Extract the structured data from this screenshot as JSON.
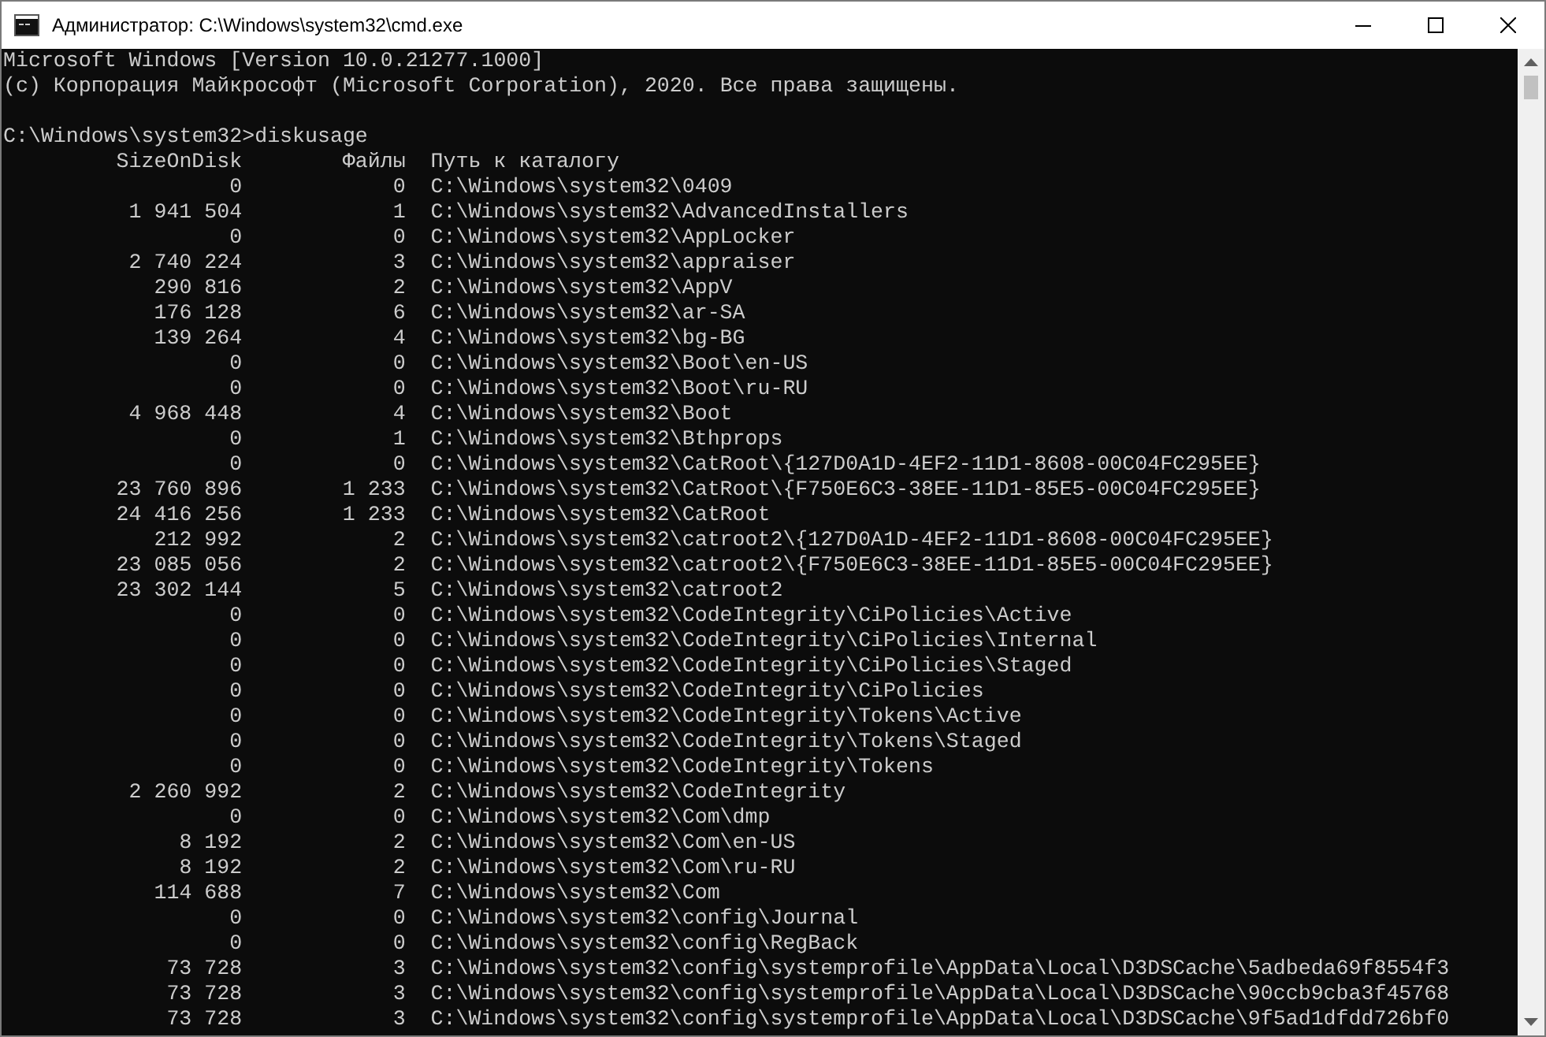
{
  "window": {
    "title": "Администратор: C:\\Windows\\system32\\cmd.exe"
  },
  "console": {
    "banner": [
      "Microsoft Windows [Version 10.0.21277.1000]",
      "(c) Корпорация Майкрософт (Microsoft Corporation), 2020. Все права защищены."
    ],
    "prompt": "C:\\Windows\\system32>diskusage",
    "table": {
      "columns": [
        "SizeOnDisk",
        "Файлы",
        "Путь к каталогу"
      ],
      "rows": [
        {
          "size": "0",
          "files": "0",
          "path": "C:\\Windows\\system32\\0409"
        },
        {
          "size": "1 941 504",
          "files": "1",
          "path": "C:\\Windows\\system32\\AdvancedInstallers"
        },
        {
          "size": "0",
          "files": "0",
          "path": "C:\\Windows\\system32\\AppLocker"
        },
        {
          "size": "2 740 224",
          "files": "3",
          "path": "C:\\Windows\\system32\\appraiser"
        },
        {
          "size": "290 816",
          "files": "2",
          "path": "C:\\Windows\\system32\\AppV"
        },
        {
          "size": "176 128",
          "files": "6",
          "path": "C:\\Windows\\system32\\ar-SA"
        },
        {
          "size": "139 264",
          "files": "4",
          "path": "C:\\Windows\\system32\\bg-BG"
        },
        {
          "size": "0",
          "files": "0",
          "path": "C:\\Windows\\system32\\Boot\\en-US"
        },
        {
          "size": "0",
          "files": "0",
          "path": "C:\\Windows\\system32\\Boot\\ru-RU"
        },
        {
          "size": "4 968 448",
          "files": "4",
          "path": "C:\\Windows\\system32\\Boot"
        },
        {
          "size": "0",
          "files": "1",
          "path": "C:\\Windows\\system32\\Bthprops"
        },
        {
          "size": "0",
          "files": "0",
          "path": "C:\\Windows\\system32\\CatRoot\\{127D0A1D-4EF2-11D1-8608-00C04FC295EE}"
        },
        {
          "size": "23 760 896",
          "files": "1 233",
          "path": "C:\\Windows\\system32\\CatRoot\\{F750E6C3-38EE-11D1-85E5-00C04FC295EE}"
        },
        {
          "size": "24 416 256",
          "files": "1 233",
          "path": "C:\\Windows\\system32\\CatRoot"
        },
        {
          "size": "212 992",
          "files": "2",
          "path": "C:\\Windows\\system32\\catroot2\\{127D0A1D-4EF2-11D1-8608-00C04FC295EE}"
        },
        {
          "size": "23 085 056",
          "files": "2",
          "path": "C:\\Windows\\system32\\catroot2\\{F750E6C3-38EE-11D1-85E5-00C04FC295EE}"
        },
        {
          "size": "23 302 144",
          "files": "5",
          "path": "C:\\Windows\\system32\\catroot2"
        },
        {
          "size": "0",
          "files": "0",
          "path": "C:\\Windows\\system32\\CodeIntegrity\\CiPolicies\\Active"
        },
        {
          "size": "0",
          "files": "0",
          "path": "C:\\Windows\\system32\\CodeIntegrity\\CiPolicies\\Internal"
        },
        {
          "size": "0",
          "files": "0",
          "path": "C:\\Windows\\system32\\CodeIntegrity\\CiPolicies\\Staged"
        },
        {
          "size": "0",
          "files": "0",
          "path": "C:\\Windows\\system32\\CodeIntegrity\\CiPolicies"
        },
        {
          "size": "0",
          "files": "0",
          "path": "C:\\Windows\\system32\\CodeIntegrity\\Tokens\\Active"
        },
        {
          "size": "0",
          "files": "0",
          "path": "C:\\Windows\\system32\\CodeIntegrity\\Tokens\\Staged"
        },
        {
          "size": "0",
          "files": "0",
          "path": "C:\\Windows\\system32\\CodeIntegrity\\Tokens"
        },
        {
          "size": "2 260 992",
          "files": "2",
          "path": "C:\\Windows\\system32\\CodeIntegrity"
        },
        {
          "size": "0",
          "files": "0",
          "path": "C:\\Windows\\system32\\Com\\dmp"
        },
        {
          "size": "8 192",
          "files": "2",
          "path": "C:\\Windows\\system32\\Com\\en-US"
        },
        {
          "size": "8 192",
          "files": "2",
          "path": "C:\\Windows\\system32\\Com\\ru-RU"
        },
        {
          "size": "114 688",
          "files": "7",
          "path": "C:\\Windows\\system32\\Com"
        },
        {
          "size": "0",
          "files": "0",
          "path": "C:\\Windows\\system32\\config\\Journal"
        },
        {
          "size": "0",
          "files": "0",
          "path": "C:\\Windows\\system32\\config\\RegBack"
        },
        {
          "size": "73 728",
          "files": "3",
          "path": "C:\\Windows\\system32\\config\\systemprofile\\AppData\\Local\\D3DSCache\\5adbeda69f8554f3"
        },
        {
          "size": "73 728",
          "files": "3",
          "path": "C:\\Windows\\system32\\config\\systemprofile\\AppData\\Local\\D3DSCache\\90ccb9cba3f45768"
        },
        {
          "size": "73 728",
          "files": "3",
          "path": "C:\\Windows\\system32\\config\\systemprofile\\AppData\\Local\\D3DSCache\\9f5ad1dfdd726bf0"
        }
      ]
    }
  }
}
